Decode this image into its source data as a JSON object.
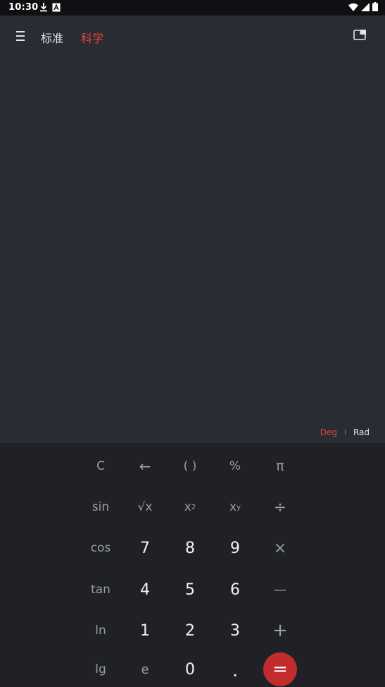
{
  "status_bar": {
    "time": "10:30",
    "icons": [
      "download-icon",
      "a-box-icon",
      "wifi-icon",
      "signal-icon",
      "battery-icon"
    ]
  },
  "header": {
    "tabs": [
      {
        "label": "标准",
        "active": false
      },
      {
        "label": "科学",
        "active": true
      }
    ]
  },
  "angle_mode": {
    "deg": "Deg",
    "separator": "I",
    "rad": "Rad",
    "selected": "Deg"
  },
  "keypad": {
    "row1": [
      "C",
      "←",
      "( )",
      "%",
      "π"
    ],
    "row2": [
      "sin",
      "√x",
      "x",
      "2",
      "x",
      "y",
      "÷"
    ],
    "row3": [
      "cos",
      "7",
      "8",
      "9",
      "×"
    ],
    "row4": [
      "tan",
      "4",
      "5",
      "6",
      "—"
    ],
    "row5": [
      "ln",
      "1",
      "2",
      "3",
      "+"
    ],
    "row6": [
      "lg",
      "e",
      "0",
      ".",
      "="
    ]
  },
  "colors": {
    "accent": "#e0463f",
    "equals_button": "#c12c2c",
    "display_bg": "#2a2c33",
    "keypad_bg": "#1f2126"
  }
}
